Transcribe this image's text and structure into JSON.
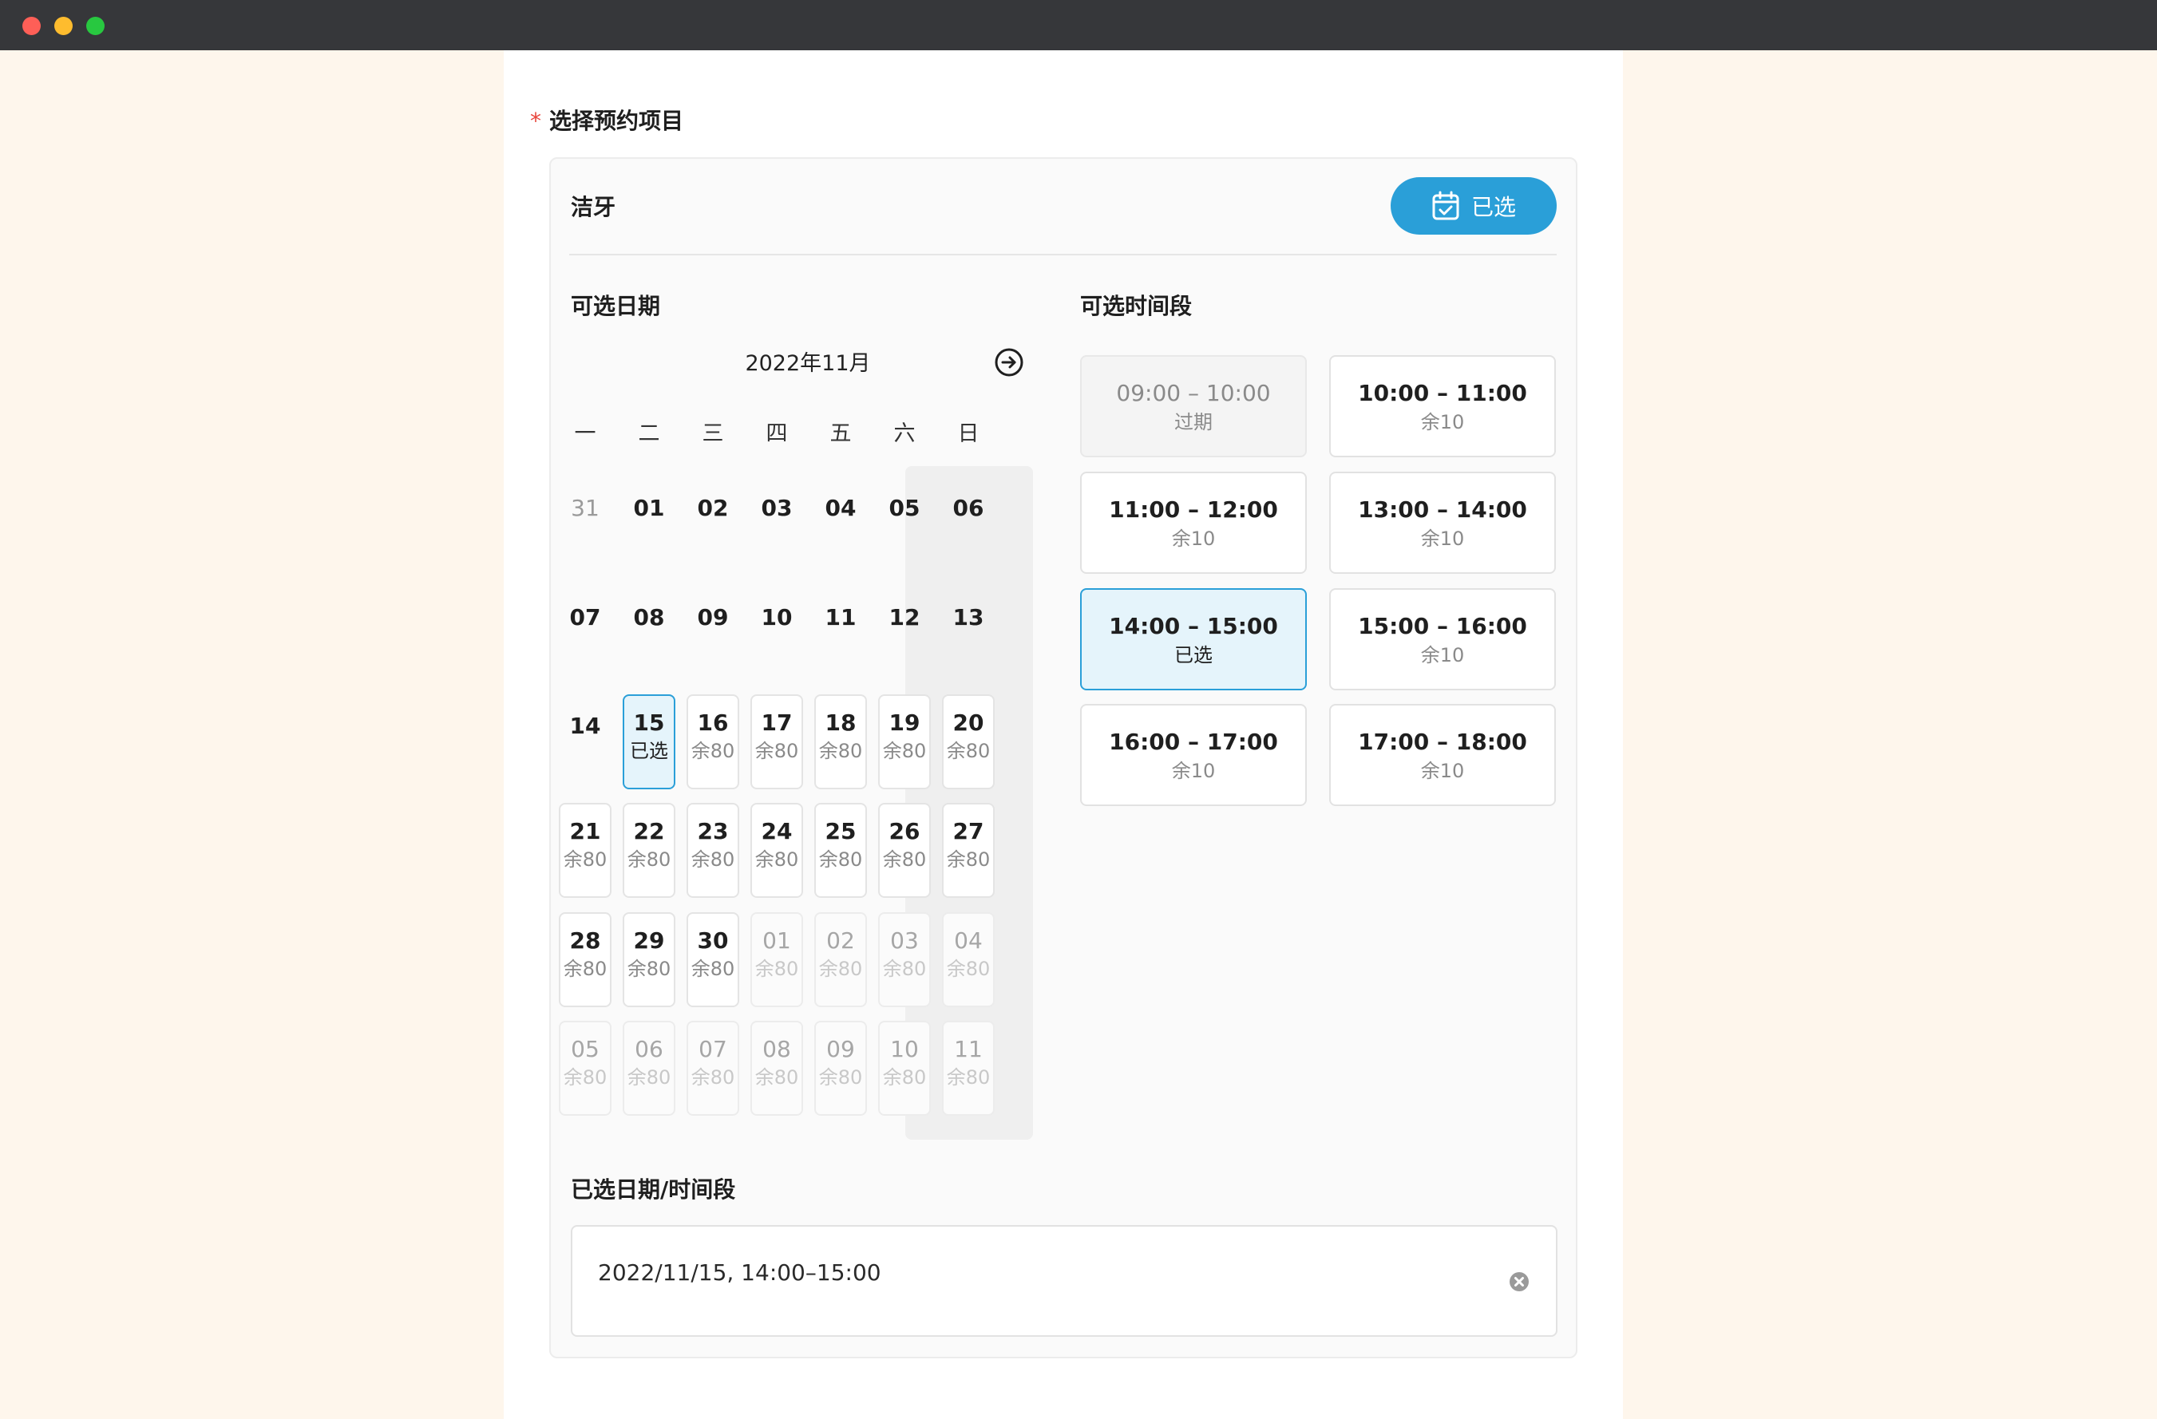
{
  "colors": {
    "accent": "#2a9fd8",
    "required": "#e8453c",
    "page_bg": "#fef6ec",
    "titlebar": "#36373a"
  },
  "form": {
    "required_mark": "*",
    "field_label": "选择预约项目"
  },
  "item": {
    "name": "洁牙",
    "button_label": "已选",
    "button_icon": "calendar-check-icon"
  },
  "date_section": {
    "title": "可选日期",
    "month": "2022年11月",
    "next_icon": "arrow-right-circle-icon",
    "weekdays": [
      "一",
      "二",
      "三",
      "四",
      "五",
      "六",
      "日"
    ],
    "plain_days": [
      {
        "label": "31",
        "muted": true
      },
      {
        "label": "01"
      },
      {
        "label": "02"
      },
      {
        "label": "03"
      },
      {
        "label": "04"
      },
      {
        "label": "05"
      },
      {
        "label": "06"
      },
      {
        "label": "07"
      },
      {
        "label": "08"
      },
      {
        "label": "09"
      },
      {
        "label": "10"
      },
      {
        "label": "11"
      },
      {
        "label": "12"
      },
      {
        "label": "13"
      },
      {
        "label": "14"
      }
    ],
    "available_days": [
      {
        "day": "15",
        "status": "已选",
        "state": "selected"
      },
      {
        "day": "16",
        "status": "余80"
      },
      {
        "day": "17",
        "status": "余80"
      },
      {
        "day": "18",
        "status": "余80"
      },
      {
        "day": "19",
        "status": "余80"
      },
      {
        "day": "20",
        "status": "余80"
      },
      {
        "day": "21",
        "status": "余80"
      },
      {
        "day": "22",
        "status": "余80"
      },
      {
        "day": "23",
        "status": "余80"
      },
      {
        "day": "24",
        "status": "余80"
      },
      {
        "day": "25",
        "status": "余80"
      },
      {
        "day": "26",
        "status": "余80"
      },
      {
        "day": "27",
        "status": "余80"
      },
      {
        "day": "28",
        "status": "余80"
      },
      {
        "day": "29",
        "status": "余80"
      },
      {
        "day": "30",
        "status": "余80"
      },
      {
        "day": "01",
        "status": "余80",
        "state": "disabled"
      },
      {
        "day": "02",
        "status": "余80",
        "state": "disabled"
      },
      {
        "day": "03",
        "status": "余80",
        "state": "disabled"
      },
      {
        "day": "04",
        "status": "余80",
        "state": "disabled"
      },
      {
        "day": "05",
        "status": "余80",
        "state": "disabled"
      },
      {
        "day": "06",
        "status": "余80",
        "state": "disabled"
      },
      {
        "day": "07",
        "status": "余80",
        "state": "disabled"
      },
      {
        "day": "08",
        "status": "余80",
        "state": "disabled"
      },
      {
        "day": "09",
        "status": "余80",
        "state": "disabled"
      },
      {
        "day": "10",
        "status": "余80",
        "state": "disabled"
      },
      {
        "day": "11",
        "status": "余80",
        "state": "disabled"
      }
    ]
  },
  "time_section": {
    "title": "可选时间段",
    "slots": [
      {
        "time": "09:00 – 10:00",
        "status": "过期",
        "state": "expired"
      },
      {
        "time": "10:00 – 11:00",
        "status": "余10"
      },
      {
        "time": "11:00 – 12:00",
        "status": "余10"
      },
      {
        "time": "13:00 – 14:00",
        "status": "余10"
      },
      {
        "time": "14:00 – 15:00",
        "status": "已选",
        "state": "selected"
      },
      {
        "time": "15:00 – 16:00",
        "status": "余10"
      },
      {
        "time": "16:00 – 17:00",
        "status": "余10"
      },
      {
        "time": "17:00 – 18:00",
        "status": "余10"
      }
    ]
  },
  "result": {
    "title": "已选日期/时间段",
    "value": "2022/11/15, 14:00–15:00",
    "clear_icon": "clear-circle-icon"
  }
}
